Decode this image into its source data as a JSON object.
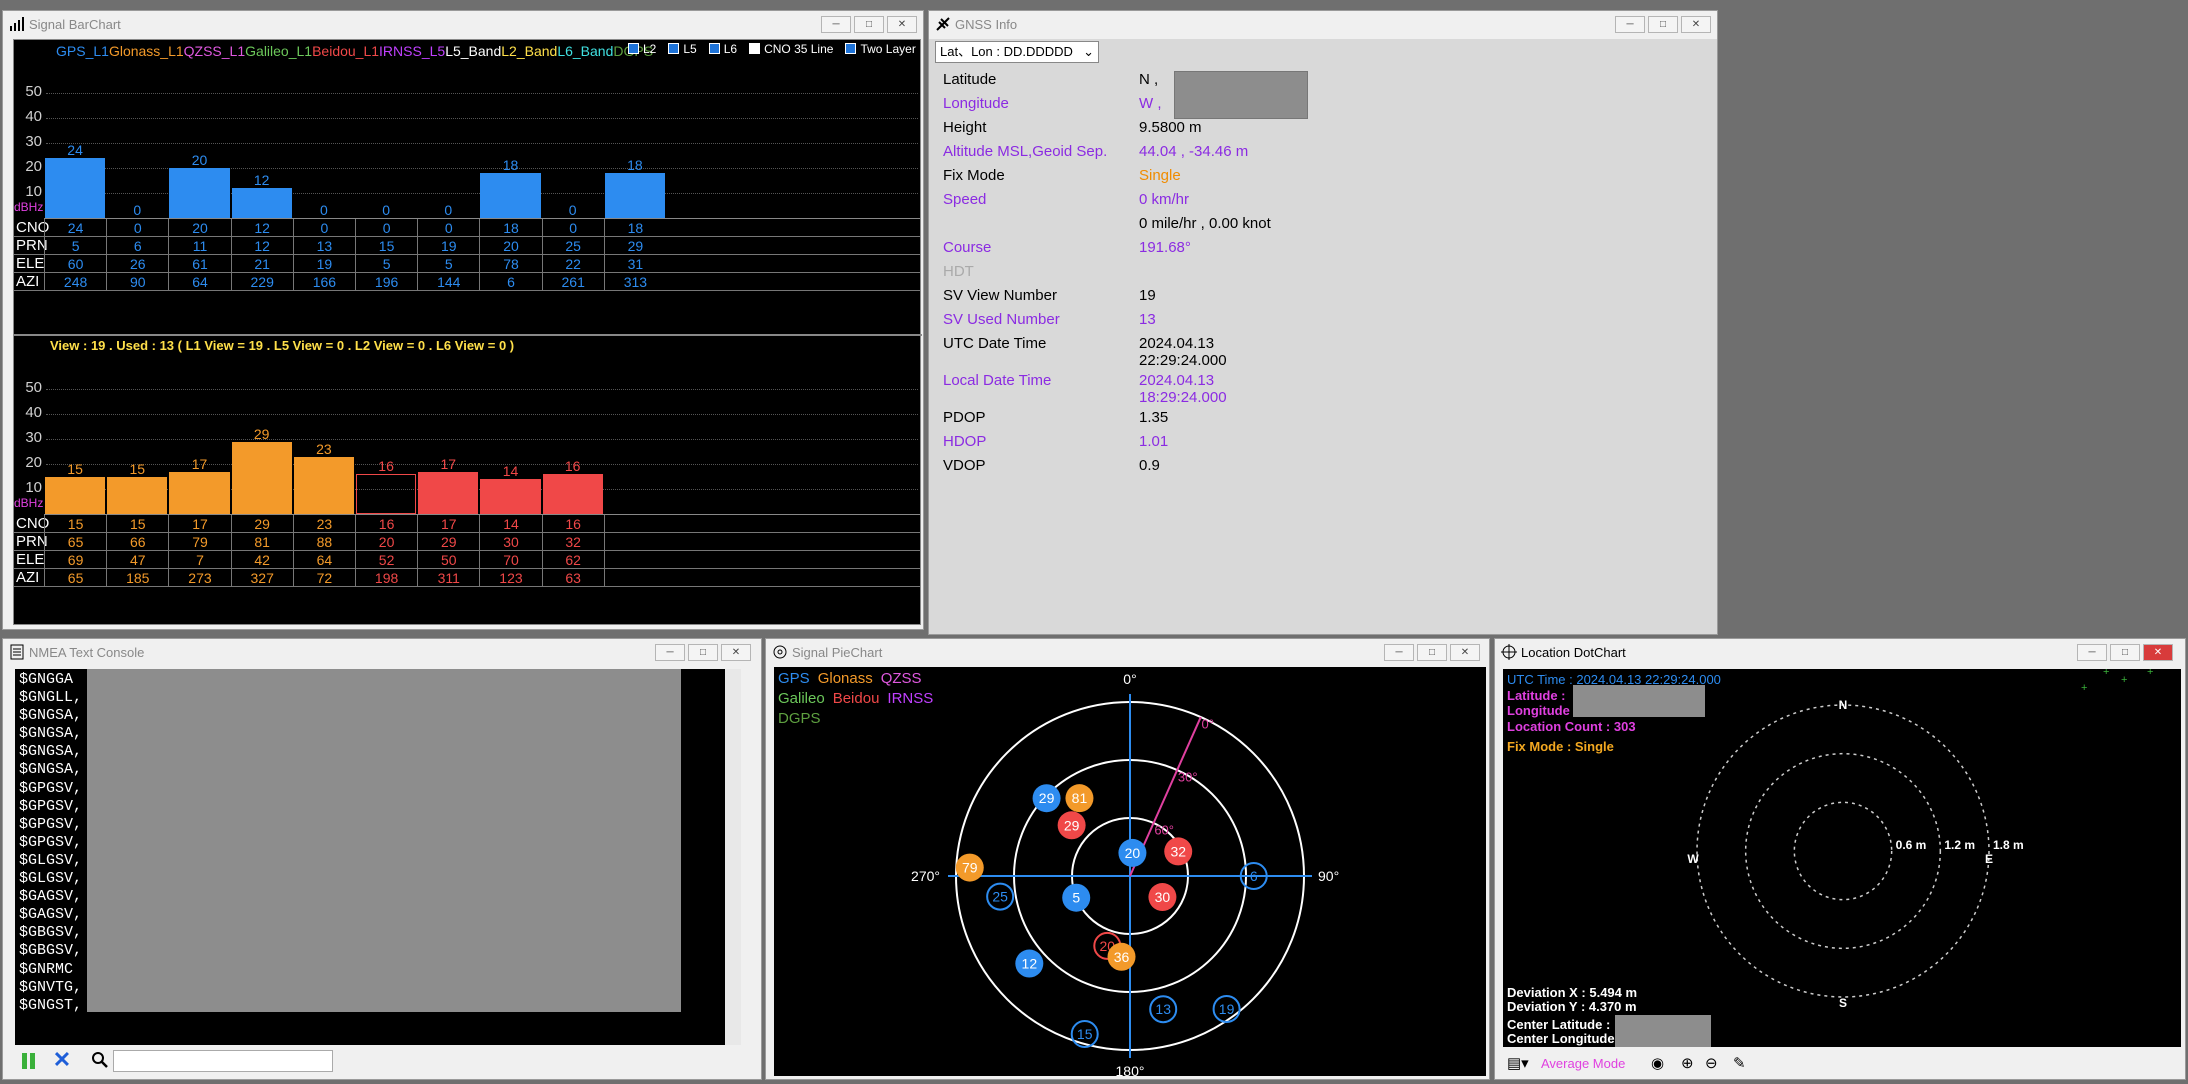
{
  "colors": {
    "gps": "#2d8cf0",
    "glonass": "#f39a2a",
    "qzss": "#e058e0",
    "galileo": "#6cc85a",
    "beidou": "#f04848",
    "irnss": "#c040ff",
    "l5": "#ffffff",
    "l2": "#ffe04a",
    "l6": "#40e0e0",
    "dgps": "#5ea040",
    "purple": "#8b2be2",
    "orange": "#f08c00"
  },
  "bar": {
    "title": "Signal BarChart",
    "legend": [
      "GPS_L1",
      "Glonass_L1",
      "QZSS_L1",
      "Galileo_L1",
      "Beidou_L1",
      "IRNSS_L5",
      "L5_Band",
      "L2_Band",
      "L6_Band",
      "DGPS"
    ],
    "checks": [
      "L2",
      "L5",
      "L6",
      "CNO 35 Line",
      "Two Layer"
    ],
    "axis": [
      "50",
      "40",
      "30",
      "20",
      "10"
    ],
    "unit": "dBHz",
    "row_labels": [
      "CNO",
      "PRN",
      "ELE",
      "AZI"
    ],
    "top": {
      "cno": [
        "24",
        "0",
        "20",
        "12",
        "0",
        "0",
        "0",
        "18",
        "0",
        "18"
      ],
      "prn": [
        "5",
        "6",
        "11",
        "12",
        "13",
        "15",
        "19",
        "20",
        "25",
        "29"
      ],
      "ele": [
        "60",
        "26",
        "61",
        "21",
        "19",
        "5",
        "5",
        "78",
        "22",
        "31"
      ],
      "azi": [
        "248",
        "90",
        "64",
        "229",
        "166",
        "196",
        "144",
        "6",
        "261",
        "313"
      ]
    },
    "bottom_header": "View : 19 . Used : 13 ( L1 View = 19 . L5 View = 0 . L2 View = 0 . L6 View = 0 )",
    "bottom": {
      "cno": [
        "15",
        "15",
        "17",
        "29",
        "23",
        "16",
        "17",
        "14",
        "16"
      ],
      "prn": [
        "65",
        "66",
        "79",
        "81",
        "88",
        "20",
        "29",
        "30",
        "32"
      ],
      "ele": [
        "69",
        "47",
        "7",
        "42",
        "64",
        "52",
        "50",
        "70",
        "62"
      ],
      "azi": [
        "65",
        "185",
        "273",
        "327",
        "72",
        "198",
        "311",
        "123",
        "63"
      ]
    }
  },
  "info": {
    "title": "GNSS Info",
    "format": "Lat、Lon : DD.DDDDD",
    "rows": [
      {
        "label": "Latitude",
        "value": "N  ,",
        "color": "#000"
      },
      {
        "label": "Longitude",
        "value": "W  ,",
        "color": "#8b2be2"
      },
      {
        "label": "Height",
        "value": "9.5800  m",
        "color": "#000"
      },
      {
        "label": "Altitude MSL,Geoid Sep.",
        "value": "44.04  ,  -34.46  m",
        "color": "#8b2be2"
      },
      {
        "label": "Fix Mode",
        "value": "Single",
        "color": "#000"
      },
      {
        "label": "Speed",
        "value": "0  km/hr",
        "color": "#8b2be2"
      },
      {
        "label": "",
        "value": "0  mile/hr  ,  0.00  knot",
        "color": "#000"
      },
      {
        "label": "Course",
        "value": "191.68°",
        "color": "#8b2be2"
      },
      {
        "label": "HDT",
        "value": "",
        "color": "#aaa"
      },
      {
        "label": "SV View Number",
        "value": "19",
        "color": "#000"
      },
      {
        "label": "SV Used Number",
        "value": "13",
        "color": "#8b2be2"
      },
      {
        "label": "UTC Date Time",
        "value": "2024.04.13",
        "value2": "22:29:24.000",
        "color": "#000"
      },
      {
        "label": "Local Date Time",
        "value": "2024.04.13",
        "value2": "18:29:24.000",
        "color": "#8b2be2"
      },
      {
        "label": "PDOP",
        "value": "1.35",
        "color": "#000"
      },
      {
        "label": "HDOP",
        "value": "1.01",
        "color": "#8b2be2"
      },
      {
        "label": "VDOP",
        "value": "0.9",
        "color": "#000"
      }
    ]
  },
  "nmea": {
    "title": "NMEA Text Console",
    "lines": [
      "$GNGGA",
      "$GNGLL,",
      "$GNGSA,",
      "$GNGSA,",
      "$GNGSA,",
      "$GNGSA,",
      "$GPGSV,",
      "$GPGSV,",
      "$GPGSV,",
      "$GPGSV,",
      "$GLGSV,",
      "$GLGSV,",
      "$GAGSV,",
      "$GAGSV,",
      "$GBGSV,",
      "$GBGSV,",
      "$GNRMC",
      "$GNVTG,",
      "$GNGST,"
    ],
    "search_placeholder": ""
  },
  "pie": {
    "title": "Signal PieChart",
    "legend": [
      "GPS",
      "Glonass",
      "QZSS",
      "Galileo",
      "Beidou",
      "IRNSS",
      "DGPS"
    ],
    "dirs": [
      "0°",
      "90°",
      "180°",
      "270°"
    ],
    "rings": [
      "0°",
      "30°",
      "60°"
    ],
    "sats": [
      {
        "prn": "29",
        "az": 313,
        "el": 31,
        "sys": "gps",
        "used": true
      },
      {
        "prn": "81",
        "az": 327,
        "el": 42,
        "sys": "glonass",
        "used": true
      },
      {
        "prn": "29",
        "az": 311,
        "el": 50,
        "sys": "beidou",
        "used": true
      },
      {
        "prn": "79",
        "az": 273,
        "el": 7,
        "sys": "glonass",
        "used": true
      },
      {
        "prn": "25",
        "az": 261,
        "el": 22,
        "sys": "gps",
        "used": false
      },
      {
        "prn": "5",
        "az": 248,
        "el": 60,
        "sys": "gps",
        "used": true
      },
      {
        "prn": "20",
        "az": 6,
        "el": 78,
        "sys": "gps",
        "used": true
      },
      {
        "prn": "32",
        "az": 63,
        "el": 62,
        "sys": "beidou",
        "used": true
      },
      {
        "prn": "30",
        "az": 123,
        "el": 70,
        "sys": "beidou",
        "used": true
      },
      {
        "prn": "6",
        "az": 90,
        "el": 26,
        "sys": "gps",
        "used": false
      },
      {
        "prn": "12",
        "az": 229,
        "el": 21,
        "sys": "gps",
        "used": true
      },
      {
        "prn": "20",
        "az": 198,
        "el": 52,
        "sys": "beidou",
        "used": false
      },
      {
        "prn": "36",
        "az": 186,
        "el": 48,
        "sys": "glonass",
        "used": true
      },
      {
        "prn": "13",
        "az": 166,
        "el": 19,
        "sys": "gps",
        "used": false
      },
      {
        "prn": "19",
        "az": 144,
        "el": 5,
        "sys": "gps",
        "used": false
      },
      {
        "prn": "15",
        "az": 196,
        "el": 5,
        "sys": "gps",
        "used": false
      }
    ]
  },
  "dot": {
    "title": "Location DotChart",
    "utc": "UTC Time : 2024.04.13 22:29:24.000",
    "lat": "Latitude :",
    "lon": "Longitude :",
    "count": "Location Count : 303",
    "fix": "Fix Mode : Single",
    "dev_x": "Deviation X : 5.494 m",
    "dev_y": "Deviation Y : 4.370 m",
    "center_lat": "Center Latitude :",
    "center_lon": "Center Longitude :",
    "rings": [
      "0.6 m",
      "1.2 m",
      "1.8 m"
    ],
    "dirs": [
      "N",
      "E",
      "S",
      "W"
    ],
    "mode": "Average Mode"
  }
}
